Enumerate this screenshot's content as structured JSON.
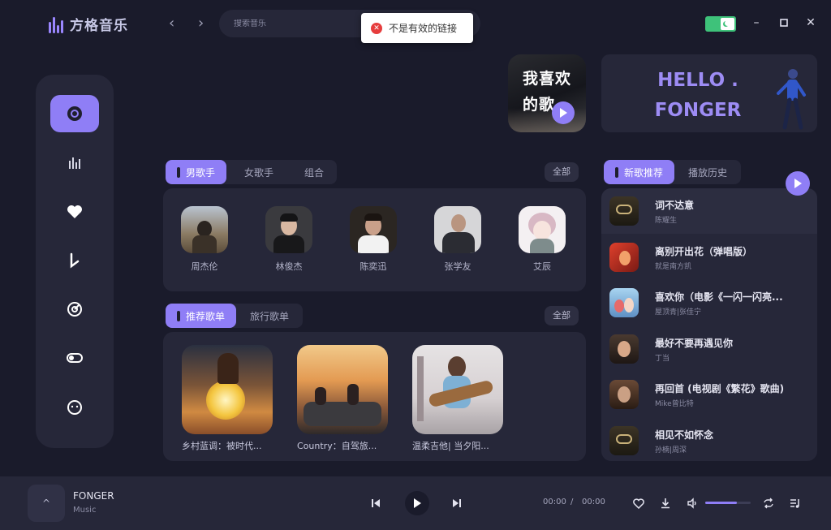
{
  "app": {
    "logo_text": "方格音乐"
  },
  "search": {
    "placeholder": "搜索音乐"
  },
  "toast": {
    "message": "不是有效的链接",
    "icon": "error-icon"
  },
  "theme": {
    "mode": "dark",
    "accent": "#8f7ef6"
  },
  "sidebar": {
    "items": [
      {
        "icon": "disc-icon",
        "active": true
      },
      {
        "icon": "chart-bars-icon",
        "active": false
      },
      {
        "icon": "heart-icon",
        "active": false
      },
      {
        "icon": "download-icon",
        "active": false
      },
      {
        "icon": "radar-icon",
        "active": false
      },
      {
        "icon": "toggle-icon",
        "active": false
      },
      {
        "icon": "face-icon",
        "active": false
      }
    ]
  },
  "banner": {
    "favorites_title": "我喜欢的歌",
    "hello_line1": "HELLO .",
    "hello_line2": "FONGER"
  },
  "artist_tabs": {
    "tabs": [
      "男歌手",
      "女歌手",
      "组合"
    ],
    "active_index": 0,
    "all_label": "全部"
  },
  "artists": [
    {
      "name": "周杰伦"
    },
    {
      "name": "林俊杰"
    },
    {
      "name": "陈奕迅"
    },
    {
      "name": "张学友"
    },
    {
      "name": "艾辰"
    }
  ],
  "playlist_tabs": {
    "tabs": [
      "推荐歌单",
      "旅行歌单"
    ],
    "active_index": 0,
    "all_label": "全部"
  },
  "playlists": [
    {
      "title": "乡村蓝调：被时代..."
    },
    {
      "title": "Country：自驾旅..."
    },
    {
      "title": "温柔吉他| 当夕阳..."
    }
  ],
  "song_tabs": {
    "tabs": [
      "新歌推荐",
      "播放历史"
    ],
    "active_index": 0
  },
  "songs": [
    {
      "title": "词不达意",
      "artist": "陈耀生"
    },
    {
      "title": "离别开出花（弹唱版）",
      "artist": "就是南方凯"
    },
    {
      "title": "喜欢你（电影《一闪一闪亮...",
      "artist": "屋顶青|张佳宁"
    },
    {
      "title": "最好不要再遇见你",
      "artist": "丁当"
    },
    {
      "title": "再回首 (电视剧《繁花》歌曲)",
      "artist": "Mike曾比特"
    },
    {
      "title": "相见不如怀念",
      "artist": "孙楠|周深"
    }
  ],
  "player": {
    "cover_icon": "^",
    "title": "FONGER",
    "subtitle": "Music",
    "current_time": "00:00",
    "separator": "/",
    "total_time": "00:00",
    "volume": 0.7
  }
}
